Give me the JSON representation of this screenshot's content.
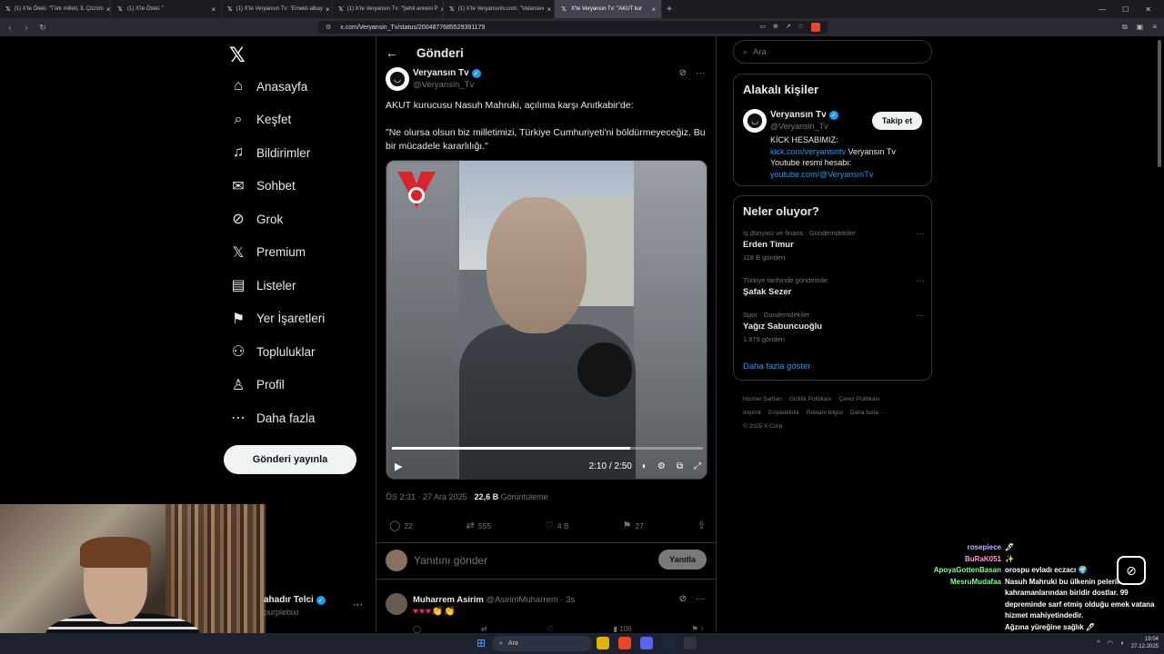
{
  "browser": {
    "tabs": [
      {
        "label": "(1) X'te Öteki: \"Türk milleti, İL Çözüm",
        "active": false
      },
      {
        "label": "(1) X'te Öteki: \" ",
        "active": false
      },
      {
        "label": "(1) X'te Veryansın Tv: \"Emekli albay",
        "active": false
      },
      {
        "label": "(1) X'te Veryansın Tv: \"Şehit annesi P",
        "active": false
      },
      {
        "label": "(1) X'te Veryansıntv.com: \"Vatansev",
        "active": false
      },
      {
        "label": "X'te Veryansın Tv: \"AKUT kur",
        "active": true
      }
    ],
    "url": "x.com/Veryansin_Tv/status/2004877685529391179"
  },
  "nav": {
    "logo": "𝕏",
    "items": [
      {
        "icon": "home-icon",
        "glyph": "⌂",
        "label": "Anasayfa"
      },
      {
        "icon": "search-icon",
        "glyph": "⌕",
        "label": "Keşfet"
      },
      {
        "icon": "bell-icon",
        "glyph": "♫",
        "label": "Bildirimler"
      },
      {
        "icon": "mail-icon",
        "glyph": "✉",
        "label": "Sohbet"
      },
      {
        "icon": "grok-icon",
        "glyph": "⊘",
        "label": "Grok"
      },
      {
        "icon": "x-premium-icon",
        "glyph": "𝕏",
        "label": "Premium"
      },
      {
        "icon": "list-icon",
        "glyph": "▤",
        "label": "Listeler"
      },
      {
        "icon": "bookmark-icon",
        "glyph": "⚑",
        "label": "Yer İşaretleri"
      },
      {
        "icon": "communities-icon",
        "glyph": "⚇",
        "label": "Topluluklar"
      },
      {
        "icon": "profile-icon",
        "glyph": "♙",
        "label": "Profil"
      },
      {
        "icon": "more-circle-icon",
        "glyph": "⋯",
        "label": "Daha fazla"
      }
    ],
    "post_button": "Gönderi yayınla",
    "account": {
      "name": "ahadır Telci",
      "handle": "purplebixi"
    }
  },
  "header": {
    "title": "Gönderi"
  },
  "post": {
    "author": "Veryansın Tv",
    "handle": "@Veryansin_Tv",
    "text1": "AKUT kurucusu Nasuh Mahruki, açılıma karşı Anıtkabir'de:",
    "text2": "\"Ne olursa olsun biz milletimizi, Türkiye Cumhuriyeti'ni böldürmeyeceğiz. Bu bir mücadele kararlılığı.\"",
    "video": {
      "time": "2:10 / 2:50",
      "progress": 0.765
    },
    "time": "ÖS 2:31 · 27 Ara 2025 · ",
    "views": "22,6 B",
    "views_label": " Görüntüleme",
    "replies": "22",
    "reposts": "555",
    "likes": "4 B",
    "bookmarks": "27"
  },
  "reply": {
    "placeholder": "Yanıtını gönder",
    "button": "Yanıtla"
  },
  "comment": {
    "name": "Muharrem Asirim",
    "handle": "@AsirimMuharrem",
    "time": "· 3s",
    "text": "♥♥♥👏👏",
    "views": "106"
  },
  "search": {
    "placeholder": "Ara"
  },
  "related": {
    "title": "Alakalı kişiler",
    "name": "Veryansın Tv",
    "handle": "@Veryansin_Tv",
    "follow": "Takip et",
    "bio_line1": "KİCK HESABIMIZ:",
    "bio_link1": "kick.com/veryansintv",
    "bio_line2": " Veryansın Tv Youtube resmi hesabı:",
    "bio_link2": "youtube.com/@VeryansınTv"
  },
  "trends": {
    "title": "Neler oluyor?",
    "items": [
      {
        "category": "İş dünyası ve finans · Gündemdekiler",
        "name": "Erden Timur",
        "count": "118 B gönderi"
      },
      {
        "category": "Türkiye tarihinde gündemde",
        "name": "Şafak Sezer",
        "count": ""
      },
      {
        "category": "Spor · Gündemdekiler",
        "name": "Yağız Sabuncuoğlu",
        "count": "1.979 gönderi"
      }
    ],
    "show_more": "Daha fazla göster"
  },
  "footer": {
    "links": [
      "Hizmet Şartları",
      "Gizlilik Politikası",
      "Çerez Politikası",
      "Imprint",
      "Erişilebilirlik",
      "Reklam bilgisi",
      "Daha fazla ···"
    ],
    "copyright": "© 2025 X Corp."
  },
  "chat": [
    {
      "user": "rosepiece",
      "color": "#b9b9ff",
      "msg": "🖊"
    },
    {
      "user": "BuRaK051",
      "color": "#ff9bd9",
      "msg": "✨"
    },
    {
      "user": "ApoyaGottenBasan",
      "color": "#7fff9a",
      "msg": "orospu evladı eczacı 🌍"
    },
    {
      "user": "MesruMudafaa",
      "color": "#7fff9a",
      "msg": "Nasuh Mahruki bu ülkenin pelerinsiz kahramanlarından biridir dostlar. 99 depreminde sarf etmiş olduğu emek vatana hizmet mahiyetindedir."
    },
    {
      "user": "",
      "color": "#ffffff",
      "msg": "Ağzına yüreğine sağlık 🖊"
    },
    {
      "user": "KKamiru",
      "color": "#6f9bff",
      "msg": "✨"
    }
  ],
  "taskbar": {
    "search": "Ara",
    "time": "19:04",
    "date": "27.12.2025"
  }
}
